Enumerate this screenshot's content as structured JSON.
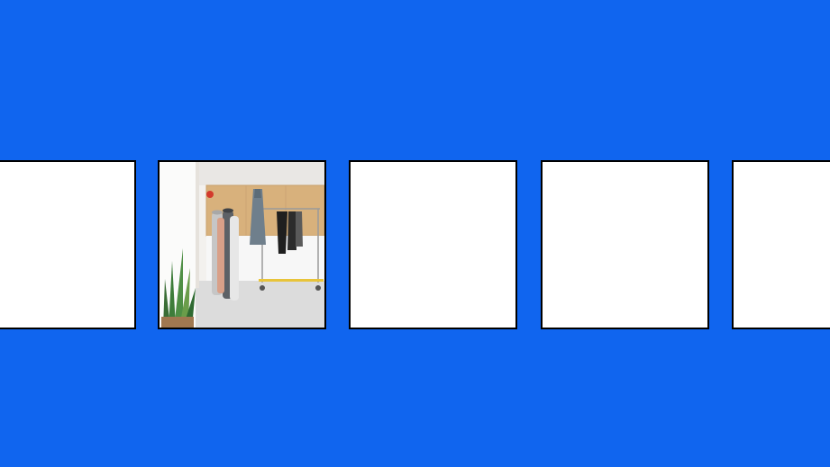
{
  "carousel": {
    "background_color": "#1065ef",
    "tile_border_color": "#000000",
    "tile_fill_color": "#ffffff",
    "tiles": [
      {
        "content": "empty"
      },
      {
        "content": "photo",
        "subject": "studio-corner-with-fabric-rolls-plant-and-clothing-rack"
      },
      {
        "content": "empty"
      },
      {
        "content": "empty"
      },
      {
        "content": "empty"
      }
    ]
  }
}
